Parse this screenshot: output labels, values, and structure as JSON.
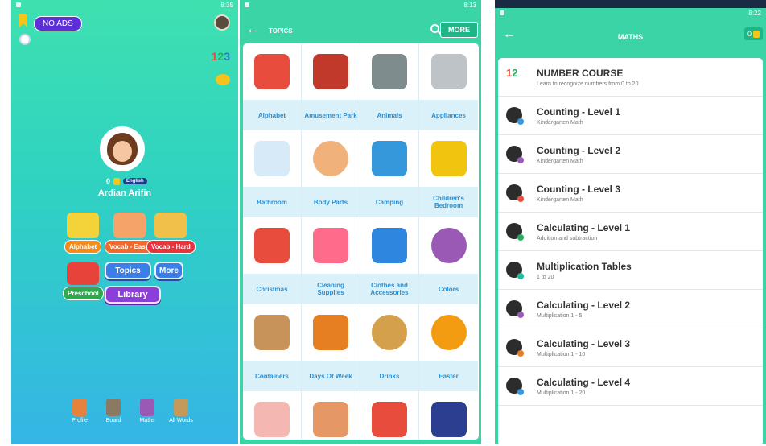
{
  "screen1": {
    "status_time": "8:35",
    "noads_label": "NO ADS",
    "score": "0",
    "language": "English",
    "username": "Ardian Arifin",
    "tiles": [
      {
        "label": "Alphabet",
        "color": "#f28c1b"
      },
      {
        "label": "Vocab - Easy",
        "color": "#ef6a2b"
      },
      {
        "label": "Vocab - Hard",
        "color": "#e8343b"
      }
    ],
    "preschool_label": "Preschool",
    "topics_label": "Topics",
    "more_label": "More",
    "library_label": "Library",
    "bottom_nav": [
      {
        "label": "Profile",
        "icon": "profile-icon"
      },
      {
        "label": "Board",
        "icon": "board-icon"
      },
      {
        "label": "Maths",
        "icon": "maths-icon"
      },
      {
        "label": "All Words",
        "icon": "all-words-icon"
      }
    ]
  },
  "screen2": {
    "status_time": "8:13",
    "title": "TOPICS",
    "more_label": "MORE",
    "topics": [
      [
        "Alphabet",
        "Amusement Park",
        "Animals",
        "Appliances"
      ],
      [
        "Bathroom",
        "Body Parts",
        "Camping",
        "Children's Bedroom"
      ],
      [
        "Christmas",
        "Cleaning Supplies",
        "Clothes and Accessories",
        "Colors"
      ],
      [
        "Containers",
        "Days Of Week",
        "Drinks",
        "Easter"
      ]
    ]
  },
  "screen3": {
    "status_time": "8:22",
    "title": "MATHS",
    "score": "0",
    "courses": [
      {
        "title": "NUMBER COURSE",
        "subtitle": "Learn to recognize numbers from 0 to 20"
      },
      {
        "title": "Counting - Level 1",
        "subtitle": "Kindergarten Math"
      },
      {
        "title": "Counting - Level 2",
        "subtitle": "Kindergarten Math"
      },
      {
        "title": "Counting - Level 3",
        "subtitle": "Kindergarten Math"
      },
      {
        "title": "Calculating - Level 1",
        "subtitle": "Addition and subtraction"
      },
      {
        "title": "Multiplication Tables",
        "subtitle": "1 to 20"
      },
      {
        "title": "Calculating - Level 2",
        "subtitle": "Multiplication 1 - 5"
      },
      {
        "title": "Calculating - Level 3",
        "subtitle": "Multiplication 1 - 10"
      },
      {
        "title": "Calculating - Level 4",
        "subtitle": "Multiplication 1 - 20"
      }
    ]
  }
}
